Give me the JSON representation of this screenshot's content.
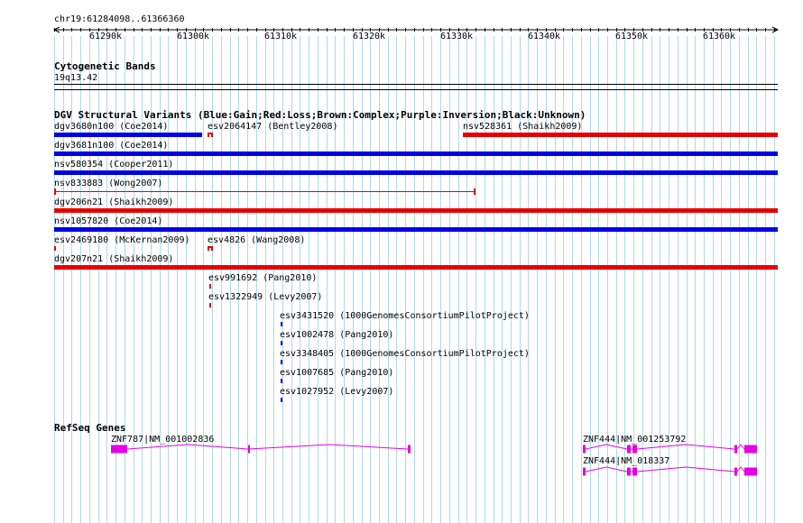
{
  "location": "chr19:61284098..61366360",
  "ruler": {
    "ticks": [
      "61290k",
      "61300k",
      "61310k",
      "61320k",
      "61330k",
      "61340k",
      "61350k",
      "61360k"
    ]
  },
  "cytoband": {
    "title": "Cytogenetic Bands",
    "band": "19q13.42"
  },
  "dgv": {
    "title": "DGV Structural Variants (Blue:Gain;Red:Loss;Brown:Complex;Purple:Inversion;Black:Unknown)",
    "colors": {
      "gain": "#0000e6",
      "loss": "#e60000"
    },
    "variants": [
      {
        "label": "dgv3680n100 (Coe2014)",
        "type": "gain"
      },
      {
        "label": "esv2064147 (Bentley2008)",
        "type": "loss"
      },
      {
        "label": "nsv528361 (Shaikh2009)",
        "type": "loss"
      },
      {
        "label": "dgv3681n100 (Coe2014)",
        "type": "gain"
      },
      {
        "label": "nsv580354 (Cooper2011)",
        "type": "gain"
      },
      {
        "label": "nsv833883 (Wong2007)",
        "type": "loss"
      },
      {
        "label": "dgv206n21 (Shaikh2009)",
        "type": "loss"
      },
      {
        "label": "nsv1057820 (Coe2014)",
        "type": "gain"
      },
      {
        "label": "esv2469180 (McKernan2009)",
        "type": "loss"
      },
      {
        "label": "esv4826 (Wang2008)",
        "type": "loss"
      },
      {
        "label": "dgv207n21 (Shaikh2009)",
        "type": "loss"
      },
      {
        "label": "esv991692 (Pang2010)",
        "type": "loss"
      },
      {
        "label": "esv1322949 (Levy2007)",
        "type": "loss"
      },
      {
        "label": "esv3431520 (1000GenomesConsortiumPilotProject)",
        "type": "gain"
      },
      {
        "label": "esv1002478 (Pang2010)",
        "type": "gain"
      },
      {
        "label": "esv3348405 (1000GenomesConsortiumPilotProject)",
        "type": "gain"
      },
      {
        "label": "esv1007685 (Pang2010)",
        "type": "gain"
      },
      {
        "label": "esv1027952 (Levy2007)",
        "type": "gain"
      }
    ]
  },
  "refseq": {
    "title": "RefSeq Genes",
    "color": "#e600e6",
    "genes": [
      {
        "label": "ZNF787|NM_001002836"
      },
      {
        "label": "ZNF444|NM_001253792"
      },
      {
        "label": "ZNF444|NM_018337"
      }
    ]
  }
}
